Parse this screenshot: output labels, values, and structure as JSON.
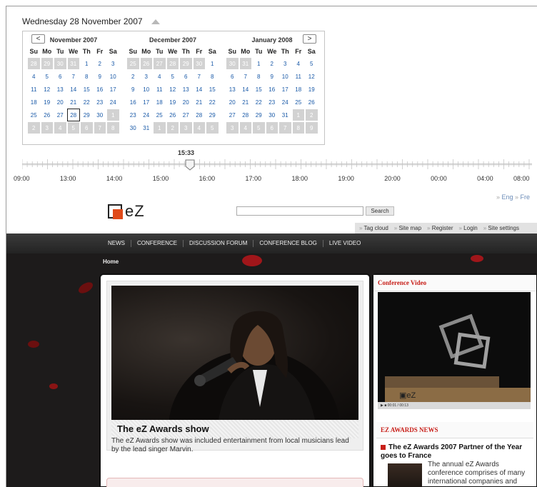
{
  "date_bar": {
    "label": "Wednesday 28 November 2007"
  },
  "calendar": {
    "prev_label": "<",
    "next_label": ">",
    "weekdays": [
      "Su",
      "Mo",
      "Tu",
      "We",
      "Th",
      "Fr",
      "Sa"
    ],
    "months": [
      {
        "title": "November 2007",
        "days": [
          [
            "28",
            "out"
          ],
          [
            "29",
            "out"
          ],
          [
            "30",
            "out"
          ],
          [
            "31",
            "out"
          ],
          [
            "1",
            "in"
          ],
          [
            "2",
            "in"
          ],
          [
            "3",
            "in"
          ],
          [
            "4",
            "in"
          ],
          [
            "5",
            "in"
          ],
          [
            "6",
            "in"
          ],
          [
            "7",
            "in"
          ],
          [
            "8",
            "in"
          ],
          [
            "9",
            "in"
          ],
          [
            "10",
            "in"
          ],
          [
            "11",
            "in"
          ],
          [
            "12",
            "in"
          ],
          [
            "13",
            "in"
          ],
          [
            "14",
            "in"
          ],
          [
            "15",
            "in"
          ],
          [
            "16",
            "in"
          ],
          [
            "17",
            "in"
          ],
          [
            "18",
            "in"
          ],
          [
            "19",
            "in"
          ],
          [
            "20",
            "in"
          ],
          [
            "21",
            "in"
          ],
          [
            "22",
            "in"
          ],
          [
            "23",
            "in"
          ],
          [
            "24",
            "in"
          ],
          [
            "25",
            "in"
          ],
          [
            "26",
            "in"
          ],
          [
            "27",
            "in"
          ],
          [
            "28",
            "sel"
          ],
          [
            "29",
            "in"
          ],
          [
            "30",
            "in"
          ],
          [
            "1",
            "out"
          ],
          [
            "2",
            "out"
          ],
          [
            "3",
            "out"
          ],
          [
            "4",
            "out"
          ],
          [
            "5",
            "out"
          ],
          [
            "6",
            "out"
          ],
          [
            "7",
            "out"
          ],
          [
            "8",
            "out"
          ]
        ]
      },
      {
        "title": "December 2007",
        "days": [
          [
            "25",
            "out"
          ],
          [
            "26",
            "out"
          ],
          [
            "27",
            "out"
          ],
          [
            "28",
            "out"
          ],
          [
            "29",
            "out"
          ],
          [
            "30",
            "out"
          ],
          [
            "1",
            "in"
          ],
          [
            "2",
            "in"
          ],
          [
            "3",
            "in"
          ],
          [
            "4",
            "in"
          ],
          [
            "5",
            "in"
          ],
          [
            "6",
            "in"
          ],
          [
            "7",
            "in"
          ],
          [
            "8",
            "in"
          ],
          [
            "9",
            "in"
          ],
          [
            "10",
            "in"
          ],
          [
            "11",
            "in"
          ],
          [
            "12",
            "in"
          ],
          [
            "13",
            "in"
          ],
          [
            "14",
            "in"
          ],
          [
            "15",
            "in"
          ],
          [
            "16",
            "in"
          ],
          [
            "17",
            "in"
          ],
          [
            "18",
            "in"
          ],
          [
            "19",
            "in"
          ],
          [
            "20",
            "in"
          ],
          [
            "21",
            "in"
          ],
          [
            "22",
            "in"
          ],
          [
            "23",
            "in"
          ],
          [
            "24",
            "in"
          ],
          [
            "25",
            "in"
          ],
          [
            "26",
            "in"
          ],
          [
            "27",
            "in"
          ],
          [
            "28",
            "in"
          ],
          [
            "29",
            "in"
          ],
          [
            "30",
            "in"
          ],
          [
            "31",
            "in"
          ],
          [
            "1",
            "out"
          ],
          [
            "2",
            "out"
          ],
          [
            "3",
            "out"
          ],
          [
            "4",
            "out"
          ],
          [
            "5",
            "out"
          ]
        ]
      },
      {
        "title": "January 2008",
        "days": [
          [
            "30",
            "out"
          ],
          [
            "31",
            "out"
          ],
          [
            "1",
            "in"
          ],
          [
            "2",
            "in"
          ],
          [
            "3",
            "in"
          ],
          [
            "4",
            "in"
          ],
          [
            "5",
            "in"
          ],
          [
            "6",
            "in"
          ],
          [
            "7",
            "in"
          ],
          [
            "8",
            "in"
          ],
          [
            "9",
            "in"
          ],
          [
            "10",
            "in"
          ],
          [
            "11",
            "in"
          ],
          [
            "12",
            "in"
          ],
          [
            "13",
            "in"
          ],
          [
            "14",
            "in"
          ],
          [
            "15",
            "in"
          ],
          [
            "16",
            "in"
          ],
          [
            "17",
            "in"
          ],
          [
            "18",
            "in"
          ],
          [
            "19",
            "in"
          ],
          [
            "20",
            "in"
          ],
          [
            "21",
            "in"
          ],
          [
            "22",
            "in"
          ],
          [
            "23",
            "in"
          ],
          [
            "24",
            "in"
          ],
          [
            "25",
            "in"
          ],
          [
            "26",
            "in"
          ],
          [
            "27",
            "in"
          ],
          [
            "28",
            "in"
          ],
          [
            "29",
            "in"
          ],
          [
            "30",
            "in"
          ],
          [
            "31",
            "in"
          ],
          [
            "1",
            "out"
          ],
          [
            "2",
            "out"
          ],
          [
            "3",
            "out"
          ],
          [
            "4",
            "out"
          ],
          [
            "5",
            "out"
          ],
          [
            "6",
            "out"
          ],
          [
            "7",
            "out"
          ],
          [
            "8",
            "out"
          ],
          [
            "9",
            "out"
          ]
        ]
      }
    ]
  },
  "timeline": {
    "current": "15:33",
    "labels": [
      "09:00",
      "13:00",
      "14:00",
      "15:00",
      "16:00",
      "17:00",
      "18:00",
      "19:00",
      "20:00",
      "00:00",
      "04:00",
      "08:00"
    ]
  },
  "lang": {
    "eng": "Eng",
    "fre": "Fre"
  },
  "site": {
    "logo_text": "eZ",
    "search_placeholder": "",
    "search_button": "Search",
    "top_links": [
      "Tag cloud",
      "Site map",
      "Register",
      "Login",
      "Site settings"
    ]
  },
  "nav": {
    "items": [
      "NEWS",
      "CONFERENCE",
      "DISCUSSION FORUM",
      "CONFERENCE BLOG",
      "LIVE VIDEO"
    ]
  },
  "breadcrumb": "Home",
  "hero": {
    "title": "The eZ Awards show",
    "description": "The eZ Awards show was included entertainment from local musicians lead by the lead singer Marvin."
  },
  "sidebar": {
    "video_heading": "Conference Video",
    "video_time": "00:01 / 00:13",
    "news_heading": "EZ AWARDS NEWS",
    "news_title": "The eZ Awards 2007 Partner of the Year goes to France",
    "news_text": "The annual eZ Awards conference comprises of many international companies and attendees that come together to"
  },
  "colors": {
    "accent_red": "#c8201a",
    "link_blue": "#1a5aa8",
    "logo_orange": "#e04a1a"
  }
}
